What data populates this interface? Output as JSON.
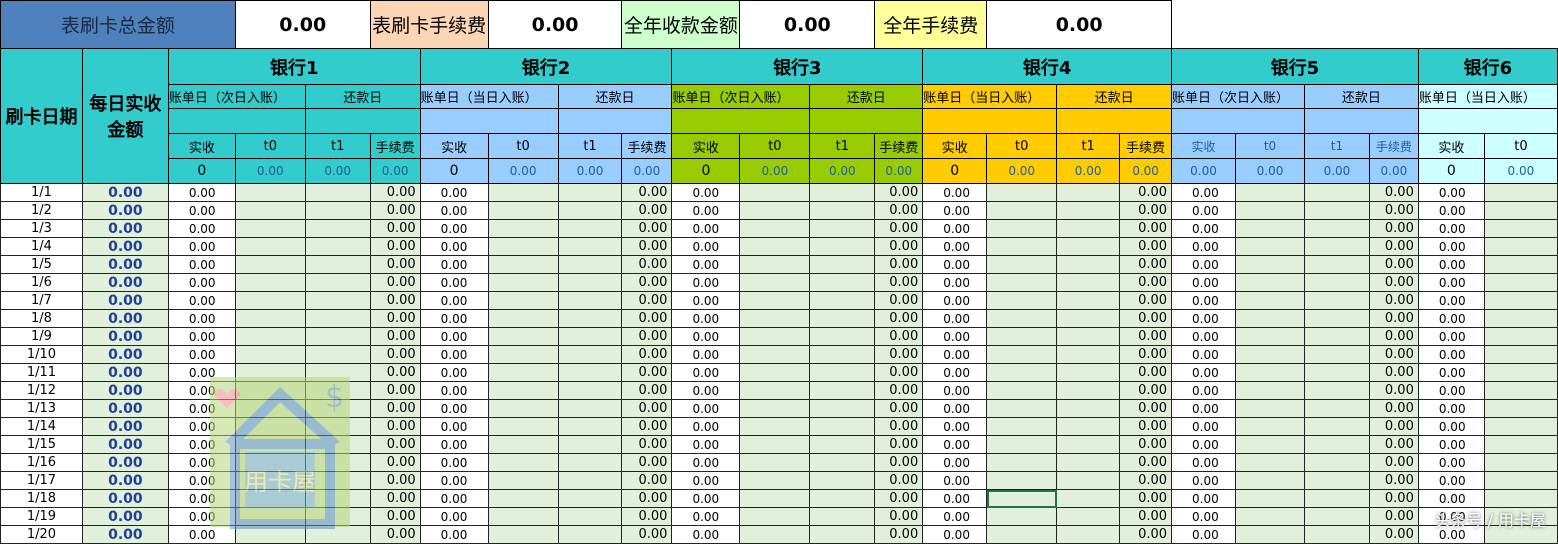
{
  "summary": [
    {
      "label": "表刷卡总金额",
      "value": "0.00",
      "color": "#4f81bd"
    },
    {
      "label": "表刷卡手续费",
      "value": "0.00",
      "color": "#fcd5b4"
    },
    {
      "label": "全年收款金额",
      "value": "0.00",
      "color": "#ccffcc"
    },
    {
      "label": "全年手续费",
      "value": "0.00",
      "color": "#ffff99"
    }
  ],
  "headers": {
    "date": "刷卡日期",
    "daily": "每日实收金额"
  },
  "banks": [
    {
      "name": "银行1",
      "bill": "账单日（次日入账）",
      "repay": "还款日",
      "color": "#33cccc",
      "cols": [
        "实收",
        "t0",
        "t1",
        "手续费"
      ],
      "totals": [
        "0",
        "0.00",
        "0.00",
        "0.00"
      ]
    },
    {
      "name": "银行2",
      "bill": "账单日（当日入账）",
      "repay": "还款日",
      "color": "#99ccff",
      "cols": [
        "实收",
        "t0",
        "t1",
        "手续费"
      ],
      "totals": [
        "0",
        "0.00",
        "0.00",
        "0.00"
      ]
    },
    {
      "name": "银行3",
      "bill": "账单日（次日入账）",
      "repay": "还款日",
      "color": "#99cc00",
      "cols": [
        "实收",
        "t0",
        "t1",
        "手续费"
      ],
      "totals": [
        "0",
        "0.00",
        "0.00",
        "0.00"
      ]
    },
    {
      "name": "银行4",
      "bill": "账单日（当日入账）",
      "repay": "还款日",
      "color": "#ffcc00",
      "cols": [
        "实收",
        "t0",
        "t1",
        "手续费"
      ],
      "totals": [
        "0",
        "0.00",
        "0.00",
        "0.00"
      ]
    },
    {
      "name": "银行5",
      "bill": "账单日（次日入账）",
      "repay": "还款日",
      "color": "#99ccff",
      "cols": [
        "实收",
        "t0",
        "t1",
        "手续费"
      ],
      "totals": [
        "0.00",
        "0.00",
        "0.00",
        "0.00"
      ]
    },
    {
      "name": "银行6",
      "bill": "账单日（当日入账）",
      "repay": "",
      "color": "#ccffff",
      "cols": [
        "实收",
        "t0"
      ],
      "totals": [
        "0",
        "0.00"
      ]
    }
  ],
  "dates": [
    "1/1",
    "1/2",
    "1/3",
    "1/4",
    "1/5",
    "1/6",
    "1/7",
    "1/8",
    "1/9",
    "1/10",
    "1/11",
    "1/12",
    "1/13",
    "1/14",
    "1/15",
    "1/16",
    "1/17",
    "1/18",
    "1/19",
    "1/20"
  ],
  "cell_value": "0.00",
  "watermark": "用卡屋",
  "credit": "头条号 / 用卡屋"
}
